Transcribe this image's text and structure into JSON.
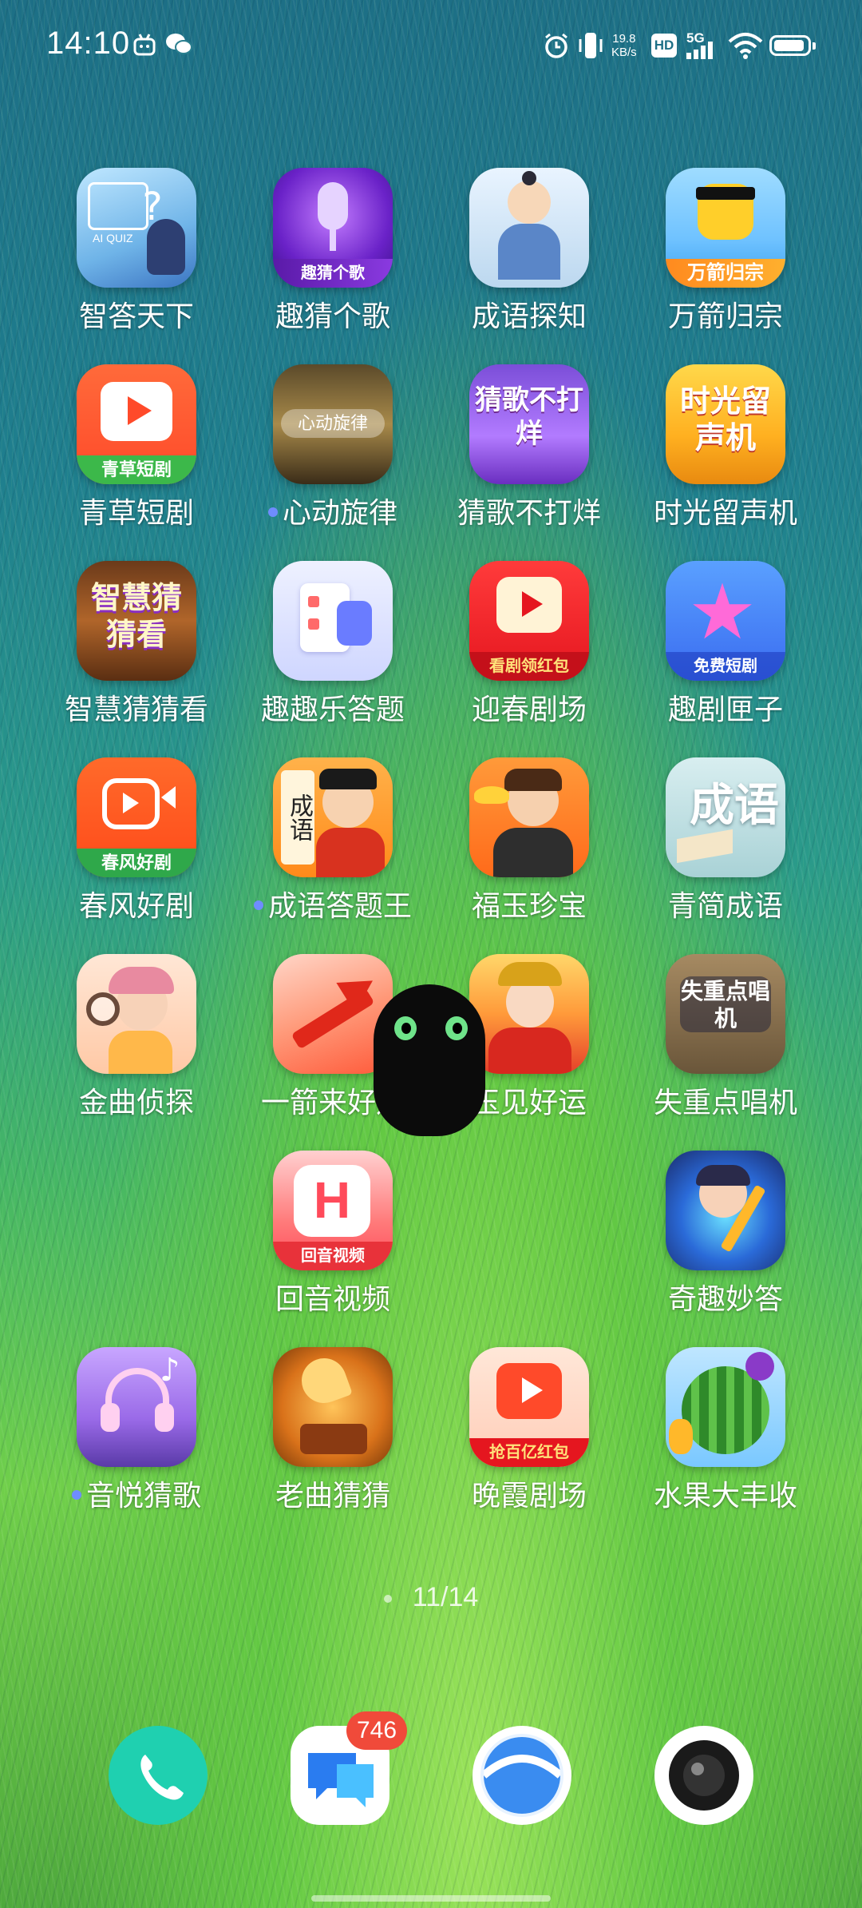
{
  "status_bar": {
    "time": "14:10",
    "net_speed_value": "19.8",
    "net_speed_unit": "KB/s",
    "hd_label": "HD",
    "network_label": "5G"
  },
  "apps": [
    {
      "label": "智答天下",
      "dot": false,
      "icon_text": "AI QUIZ",
      "icon": "quiz-icon"
    },
    {
      "label": "趣猜个歌",
      "dot": false,
      "icon_text": "趣猜个歌",
      "icon": "microphone-icon"
    },
    {
      "label": "成语探知",
      "dot": false,
      "icon_text": "",
      "icon": "scholar-icon"
    },
    {
      "label": "万箭归宗",
      "dot": false,
      "icon_text": "万箭归宗",
      "icon": "arrows-icon"
    },
    {
      "label": "青草短剧",
      "dot": false,
      "icon_text": "青草短剧",
      "icon": "clapper-icon"
    },
    {
      "label": "心动旋律",
      "dot": true,
      "icon_text": "心动旋律",
      "icon": "melody-icon"
    },
    {
      "label": "猜歌不打烊",
      "dot": false,
      "icon_text": "猜歌不打烊",
      "icon": "guitar-icon"
    },
    {
      "label": "时光留声机",
      "dot": false,
      "icon_text": "时光留声机",
      "icon": "gramophone-icon"
    },
    {
      "label": "智慧猜猜看",
      "dot": false,
      "icon_text": "智慧猜猜看",
      "icon": "books-icon"
    },
    {
      "label": "趣趣乐答题",
      "dot": false,
      "icon_text": "",
      "icon": "checklist-icon"
    },
    {
      "label": "迎春剧场",
      "dot": false,
      "icon_text": "看剧领红包",
      "icon": "tv-play-icon"
    },
    {
      "label": "趣剧匣子",
      "dot": false,
      "icon_text": "免费短剧",
      "icon": "star-play-icon"
    },
    {
      "label": "春风好剧",
      "dot": false,
      "icon_text": "春风好剧",
      "icon": "camera-play-icon"
    },
    {
      "label": "成语答题王",
      "dot": true,
      "icon_text": "成语",
      "icon": "scroll-icon"
    },
    {
      "label": "福玉珍宝",
      "dot": false,
      "icon_text": "",
      "icon": "gold-ingot-icon"
    },
    {
      "label": "青简成语",
      "dot": false,
      "icon_text": "成语",
      "icon": "book-icon"
    },
    {
      "label": "金曲侦探",
      "dot": false,
      "icon_text": "",
      "icon": "magnifier-icon"
    },
    {
      "label": "一箭来好运",
      "dot": false,
      "icon_text": "",
      "icon": "arrow-icon"
    },
    {
      "label": "玉见好运",
      "dot": false,
      "icon_text": "",
      "icon": "goddess-icon"
    },
    {
      "label": "失重点唱机",
      "dot": false,
      "icon_text": "失重点唱机",
      "icon": "jukebox-icon"
    },
    {
      "label": "回音视频",
      "dot": false,
      "icon_text": "回音视频",
      "icon": "h-play-icon"
    },
    {
      "label": "奇趣妙答",
      "dot": false,
      "icon_text": "",
      "icon": "pencil-icon"
    },
    {
      "label": "音悦猜歌",
      "dot": true,
      "icon_text": "",
      "icon": "headphones-icon"
    },
    {
      "label": "老曲猜猜",
      "dot": false,
      "icon_text": "",
      "icon": "phonograph-icon"
    },
    {
      "label": "晚霞剧场",
      "dot": false,
      "icon_text": "抢百亿红包",
      "icon": "tv-play-icon"
    },
    {
      "label": "水果大丰收",
      "dot": false,
      "icon_text": "",
      "icon": "watermelon-icon"
    }
  ],
  "page_indicator": "11/14",
  "dock": {
    "messages_badge": "746"
  }
}
